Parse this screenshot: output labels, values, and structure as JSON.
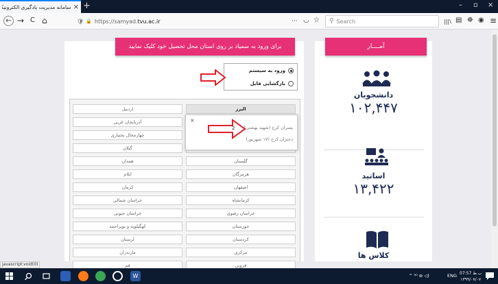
{
  "browser": {
    "tab_title": "سامانه مدیریت یادگیری الکترونیکی دانـ",
    "tab_close": "×",
    "new_tab": "+",
    "url_host": "https://samyad.",
    "url_domain": "tvu.ac.ir",
    "search_placeholder": "Search",
    "icons": {
      "back": "←",
      "forward": "→",
      "reload": "C",
      "home": "⌂",
      "shield": "🛡",
      "lock": "🔒",
      "more": "···",
      "pocket": "◡",
      "star": "☆",
      "library": "|||\\",
      "sidebar": "▤",
      "addon": "☸",
      "account": "◉",
      "menu": "≡",
      "minimize": "–",
      "maximize": "▫",
      "close": "×"
    }
  },
  "banner_text": "برای ورود به سمیاد بر روی استان محل تحصیل خود کلیک نمایید",
  "stats_header": "آمــــار",
  "login_options": [
    {
      "label": "ورود به سیستم",
      "selected": true
    },
    {
      "label": "بازگشایی فایل",
      "selected": false
    }
  ],
  "provinces": {
    "right": [
      "البرز",
      "",
      "",
      "",
      "گلستان",
      "هرمزگان",
      "اصفهان",
      "کرمانشاه",
      "خراسان رضوی",
      "خوزستان",
      "کردستان",
      "مرکزی",
      "قزوین"
    ],
    "left": [
      "اردبیل",
      "آذربایجان غربی",
      "چهارمحال بختیاری",
      "گیلان",
      "همدان",
      "ایلام",
      "کرمان",
      "خراسان شمالی",
      "خراسان جنوبی",
      "کهگیلویه و بویراحمد",
      "لرستان",
      "مازندران",
      "قم"
    ]
  },
  "popup": {
    "close": "×",
    "items": [
      "پسران کرج (شهید بهشتی)",
      "دختران کرج (۱۷ شهریور)"
    ],
    "annotation": "2"
  },
  "stats": [
    {
      "label": "دانشجویان",
      "value": "۱۰۲,۴۴۷",
      "icon": "students-icon"
    },
    {
      "label": "اساتید",
      "value": "۱۳,۴۲۲",
      "icon": "teachers-icon"
    },
    {
      "label": "کلاس ها",
      "value": "",
      "icon": "classes-icon"
    }
  ],
  "status_text": "javascript:void(0)",
  "taskbar": {
    "tray_lang": "ENG",
    "tray_time": "07:57 ب.ظ",
    "tray_date": "۱۳۹۹/۰۷/۰۷",
    "tray_icons": "^ ⁹⁰ ⊚ ◁)"
  },
  "colors": {
    "accent": "#e63176",
    "stat_text": "#1e2a52",
    "arrow": "#e0202a",
    "taskbar": "#0d1b30"
  }
}
